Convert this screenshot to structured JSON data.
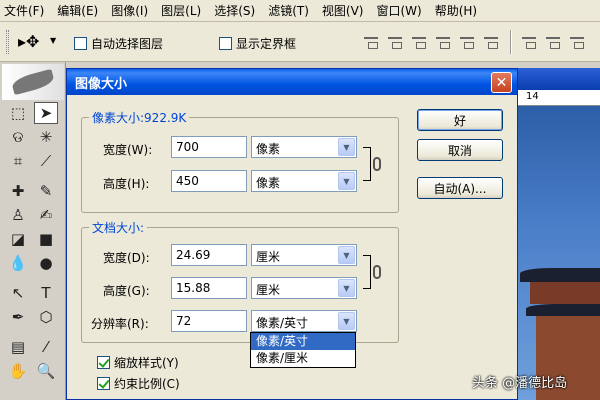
{
  "menubar": {
    "items": [
      "文件(F)",
      "编辑(E)",
      "图像(I)",
      "图层(L)",
      "选择(S)",
      "滤镜(T)",
      "视图(V)",
      "窗口(W)",
      "帮助(H)"
    ]
  },
  "options": {
    "auto_select_label": "自动选择图层",
    "show_bounds_label": "显示定界框",
    "auto_select_checked": false,
    "show_bounds_checked": false
  },
  "ruler": {
    "mark": "14"
  },
  "dialog": {
    "title": "图像大小",
    "close_label": "✕",
    "pixel_group": {
      "legend": "像素大小:922.9K",
      "width_label": "宽度(W):",
      "width_value": "700",
      "width_unit": "像素",
      "height_label": "高度(H):",
      "height_value": "450",
      "height_unit": "像素"
    },
    "doc_group": {
      "legend": "文档大小:",
      "width_label": "宽度(D):",
      "width_value": "24.69",
      "width_unit": "厘米",
      "height_label": "高度(G):",
      "height_value": "15.88",
      "height_unit": "厘米",
      "res_label": "分辨率(R):",
      "res_value": "72",
      "res_unit": "像素/英寸"
    },
    "res_dropdown": {
      "options": [
        "像素/英寸",
        "像素/厘米"
      ],
      "highlighted": "像素/英寸"
    },
    "buttons": {
      "ok": "好",
      "cancel": "取消",
      "auto": "自动(A)..."
    },
    "checkboxes": {
      "scale_styles": "缩放样式(Y)",
      "constrain": "约束比例(C)",
      "scale_styles_checked": true,
      "constrain_checked": true
    }
  },
  "watermark": "头条 @潘德比岛",
  "colors": {
    "title_bar": "#0054e3",
    "legend_text": "#0046d5",
    "dropdown_highlight": "#316ac5"
  }
}
